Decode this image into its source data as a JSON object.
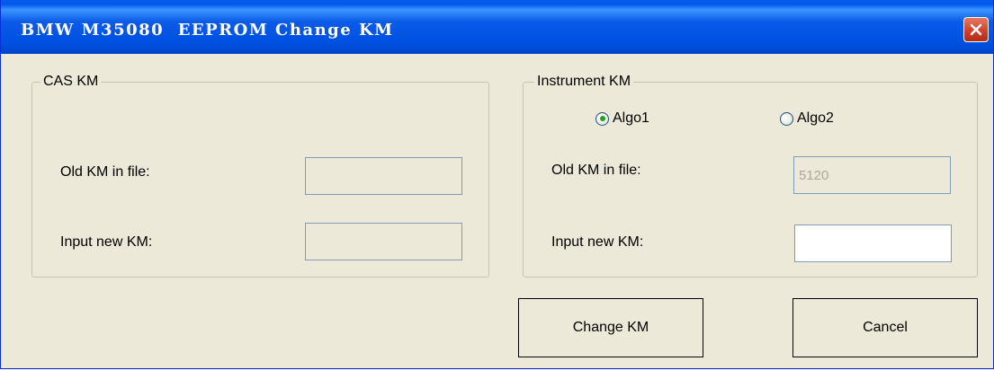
{
  "window": {
    "title": "BMW M35080  EEPROM Change KM",
    "close_icon": "close-icon"
  },
  "cas_group": {
    "legend": "CAS KM",
    "old_km_label": "Old KM in file:",
    "old_km_value": "",
    "new_km_label": "Input new KM:",
    "new_km_value": ""
  },
  "instrument_group": {
    "legend": "Instrument KM",
    "algo1_label": "Algo1",
    "algo1_checked": true,
    "algo2_label": "Algo2",
    "algo2_checked": false,
    "old_km_label": "Old KM in file:",
    "old_km_value": "5120",
    "new_km_label": "Input new KM:",
    "new_km_value": ""
  },
  "buttons": {
    "change_km": "Change KM",
    "cancel": "Cancel"
  },
  "colors": {
    "titlebar": "#0A5BE8",
    "dialog_bg": "#ECE9D8",
    "close_button": "#D1402A",
    "radio_dot": "#21A121"
  }
}
